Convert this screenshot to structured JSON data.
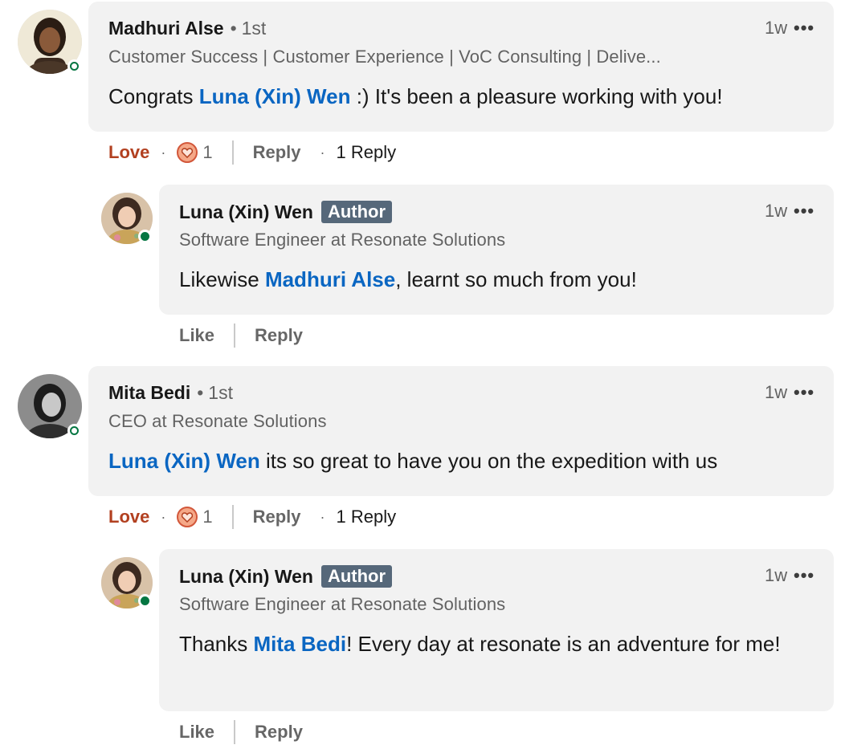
{
  "comments": [
    {
      "author": "Madhuri Alse",
      "degree": "1st",
      "headline": "Customer Success | Customer Experience | VoC Consulting | Delive...",
      "time": "1w",
      "mention": "Luna (Xin) Wen",
      "text_before": "Congrats ",
      "text_after": " :) It's been a pleasure working with you!",
      "reaction_label": "Love",
      "reaction_count": "1",
      "reply_label": "Reply",
      "replies_count_label": "1 Reply",
      "reply": {
        "author": "Luna (Xin) Wen",
        "badge": "Author",
        "headline": "Software Engineer at Resonate Solutions",
        "time": "1w",
        "text_before": "Likewise ",
        "mention": "Madhuri Alse",
        "text_after": ", learnt so much from you!",
        "like_label": "Like",
        "reply_label": "Reply"
      }
    },
    {
      "author": "Mita Bedi",
      "degree": "1st",
      "headline": "CEO at Resonate Solutions",
      "time": "1w",
      "mention": "Luna (Xin) Wen",
      "text_before": "",
      "text_after": " its so great to have you on the expedition with us",
      "reaction_label": "Love",
      "reaction_count": "1",
      "reply_label": "Reply",
      "replies_count_label": "1 Reply",
      "reply": {
        "author": "Luna (Xin) Wen",
        "badge": "Author",
        "headline": "Software Engineer at Resonate Solutions",
        "time": "1w",
        "text_before": "Thanks ",
        "mention": "Mita Bedi",
        "text_after": "! Every day at resonate is an adventure for me!",
        "like_label": "Like",
        "reply_label": "Reply"
      }
    }
  ],
  "colors": {
    "mention": "#0a66c2",
    "love": "#b24020",
    "author_badge": "#56687a",
    "presence": "#057642",
    "bubble": "#f2f2f2"
  },
  "icons": {
    "more": "more-horizontal-icon",
    "reaction": "heart-icon"
  }
}
